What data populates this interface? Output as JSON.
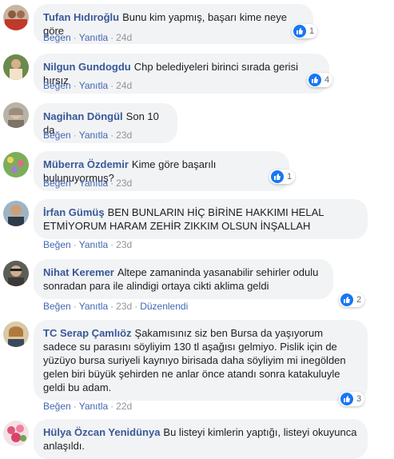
{
  "comments": [
    {
      "author": "Tufan Hıdıroğlu",
      "text": "Bunu kim yapmış, başarı kime neye göre",
      "time": "24d",
      "reactions": "1"
    },
    {
      "author": "Nilgun Gundogdu",
      "text": "Chp belediyeleri birinci sırada gerisi hırsız",
      "time": "24d",
      "reactions": "4"
    },
    {
      "author": "Nagihan Döngül",
      "text": "Son 10 da",
      "time": "23d"
    },
    {
      "author": "Müberra Özdemir",
      "text": "Kime göre başarılı bulunuyormuş?",
      "time": "23d",
      "reactions": "1"
    },
    {
      "author": "İrfan Gümüş",
      "text": "BEN BUNLARIN HİÇ BİRİNE HAKKIMI HELAL ETMİYORUM HARAM ZEHİR ZIKKIM OLSUN İNŞALLAH",
      "time": "23d"
    },
    {
      "author": "Nihat Keremer",
      "text": "Altepe zamaninda yasanabilir sehirler odulu sonradan para ile alindigi ortaya cikti aklima geldi",
      "time": "23d",
      "edited": "Düzenlendi",
      "reactions": "2"
    },
    {
      "author": "TC Serap Çamlıöz",
      "text": "Şakamısınız siz ben Bursa da yaşıyorum sadece su parasını söyliyim 130 tl aşağısı gelmiyo. Pislik için de yüzüyo bursa suriyeli kaynıyo birisada daha söyliyim mi inegölden gelen biri büyük şehirden ne anlar önce atandı sonra katakuluyle geldi bu adam.",
      "time": "22d",
      "reactions": "3"
    },
    {
      "author": "Hülya Özcan Yenidünya",
      "text": "Bu listeyi kimlerin yaptığı, listeyi okuyunca anlaşıldı."
    }
  ],
  "actions": {
    "like": "Beğen",
    "reply": "Yanıtla",
    "sep": "·"
  },
  "colors": {
    "author": "#385898",
    "link": "#4267b2",
    "bubble": "#f2f3f5",
    "like": "#1877f2"
  },
  "icons": {
    "reaction": "like-icon"
  }
}
